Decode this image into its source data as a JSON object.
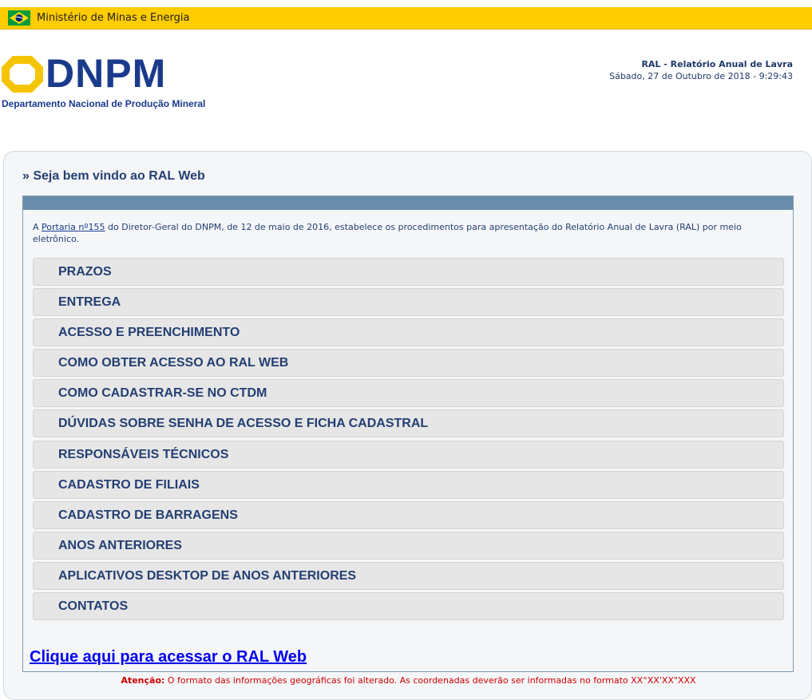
{
  "gov_bar": {
    "label": "Ministério de Minas e Energia",
    "flag_icon": "brazil-flag-icon"
  },
  "logo": {
    "wordmark": "DNPM",
    "subtitle": "Departamento Nacional de Produção Mineral",
    "mark_color": "#f5c400",
    "brand_color": "#1a3a8c"
  },
  "header": {
    "system_title": "RAL - Relatório Anual de Lavra",
    "datetime": "Sábado, 27 de Outubro de 2018 - 9:29:43"
  },
  "main": {
    "welcome": "» Seja bem vindo ao RAL Web",
    "intro_prefix": "A ",
    "intro_link": "Portaria nº155",
    "intro_suffix": " do Diretor-Geral do DNPM, de 12 de maio de 2016, estabelece os procedimentos para apresentação do Relatório Anual de Lavra (RAL) por meio eletrônico.",
    "sections": [
      "PRAZOS",
      "ENTREGA",
      "ACESSO E PREENCHIMENTO",
      "COMO OBTER ACESSO AO RAL WEB",
      "COMO CADASTRAR-SE NO CTDM",
      "DÚVIDAS SOBRE SENHA DE ACESSO E FICHA CADASTRAL",
      "RESPONSÁVEIS TÉCNICOS",
      "CADASTRO DE FILIAIS",
      "CADASTRO DE BARRAGENS",
      "ANOS ANTERIORES",
      "APLICATIVOS DESKTOP DE ANOS ANTERIORES",
      "CONTATOS"
    ],
    "access_link": "Clique aqui para acessar o RAL Web"
  },
  "notice": {
    "label": "Atenção:",
    "text": " O formato das informações geográficas foi alterado. As coordenadas deverão ser informadas no formato XX°XX'XX\"XXX",
    "color": "#cc0000"
  }
}
